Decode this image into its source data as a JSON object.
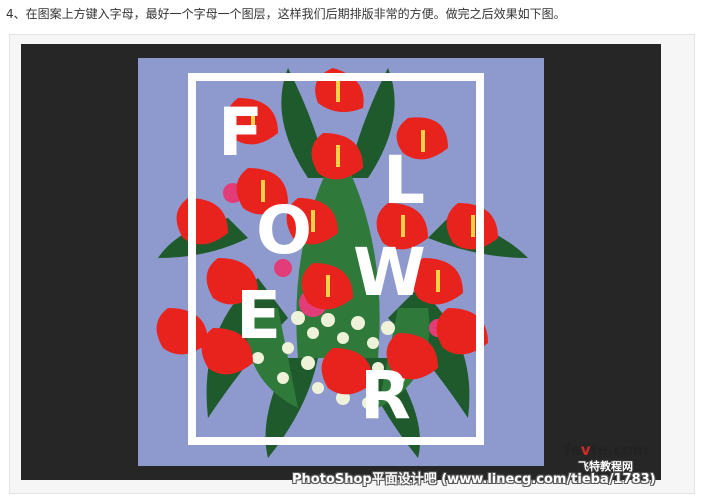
{
  "article": {
    "step_text": "4、在图案上方键入字母，最好一个字母一个图层，这样我们后期排版非常的方便。做完之后效果如下图。"
  },
  "poster": {
    "letters": [
      "F",
      "L",
      "O",
      "W",
      "E",
      "R"
    ],
    "background_color": "#8e99cd",
    "canvas_color": "#262626",
    "frame_color": "#ffffff"
  },
  "watermark": {
    "bottom_text": "PhotoShop平面设计吧 (www.linecg.com/tieba/1783)",
    "logo_text_a": "fe",
    "logo_text_v": "v",
    "logo_text_b": "te.com",
    "logo_sub": "飞特教程网"
  }
}
